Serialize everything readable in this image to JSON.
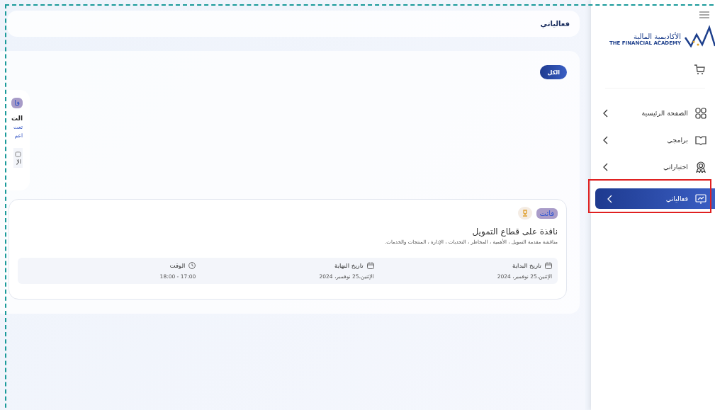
{
  "sidebar": {
    "logo": {
      "name_ar": "الأكاديمية المالية",
      "name_en": "THE FINANCIAL ACADEMY"
    },
    "items": [
      {
        "label": "الصفحة الرئيسية",
        "selected": false
      },
      {
        "label": "برامجي",
        "selected": false
      },
      {
        "label": "اختباراتي",
        "selected": false
      },
      {
        "label": "فعالياتي",
        "selected": true
      }
    ]
  },
  "header": {
    "title": "فعالياتي"
  },
  "filters": [
    {
      "label": "الكل",
      "selected": true
    }
  ],
  "partial_card": {
    "badge": "فا",
    "title": "الت",
    "lines": [
      "تعت",
      "اعم"
    ],
    "info": "الإ"
  },
  "events": [
    {
      "status": "فائت",
      "title": "نافذة على قطاع التمويل",
      "description": "مناقشة مقدمة التمويل ، الأهمية ، المخاطر ، التحديات ، الإدارة ، المنتجات والخدمات.",
      "fields": [
        {
          "kind": "date",
          "label": "تاريخ البداية",
          "value": "الإثنين،25 نوفمبر، 2024"
        },
        {
          "kind": "date",
          "label": "تاريخ النهاية",
          "value": "الإثنين،25 نوفمبر، 2024"
        },
        {
          "kind": "time",
          "label": "الوقت",
          "value": "17:00 - 18:00"
        }
      ]
    }
  ]
}
